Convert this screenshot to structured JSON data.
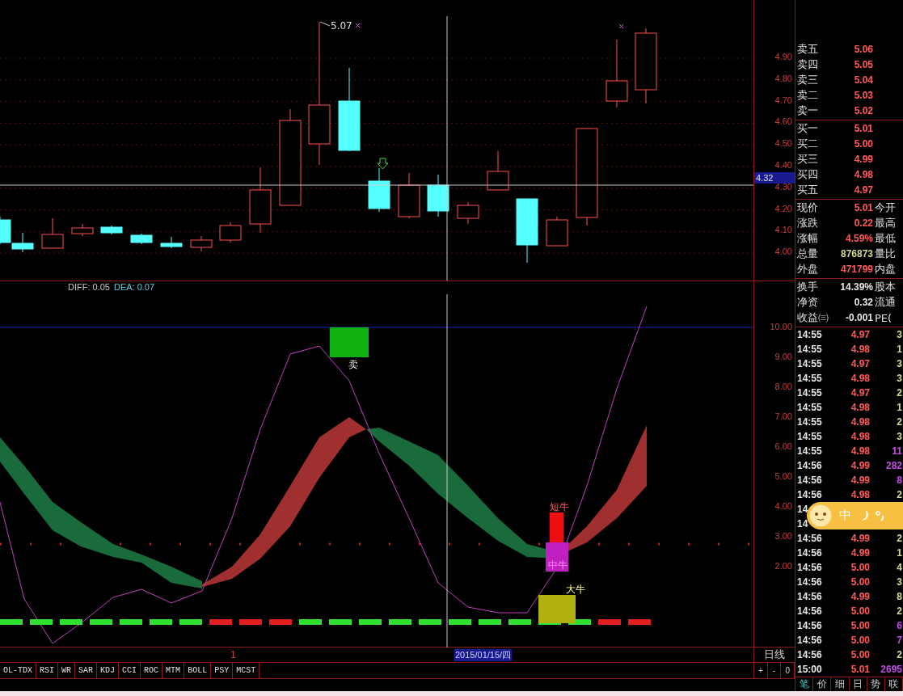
{
  "price_pane": {
    "high_label": "5.07",
    "cursor_price": "4.32",
    "y_ticks": [
      "4.90",
      "4.80",
      "4.70",
      "4.60",
      "4.50",
      "4.40",
      "4.30",
      "4.20",
      "4.10",
      "4.00"
    ]
  },
  "indicator_pane": {
    "legend": [
      {
        "label": "DIFF: 0.05",
        "color": "#c8c8c8"
      },
      {
        "label": "DEA: 0.07",
        "color": "#60c8d8"
      }
    ],
    "y_ticks": [
      "10.00",
      "9.00",
      "8.00",
      "7.00",
      "6.00",
      "5.00",
      "4.00",
      "3.00",
      "2.00"
    ],
    "signals": [
      {
        "label": "卖",
        "kind": "sell"
      },
      {
        "label": "短牛",
        "kind": "short"
      },
      {
        "label": "中牛",
        "kind": "mid"
      },
      {
        "label": "大牛",
        "kind": "long"
      }
    ]
  },
  "date_bar": {
    "marker": "1",
    "cursor_date": "2015/01/15/四"
  },
  "period": "日线",
  "zoom_buttons": [
    "+",
    "-",
    "0"
  ],
  "indicator_tabs": [
    "OL-TDX",
    "RSI",
    "WR",
    "SAR",
    "KDJ",
    "CCI",
    "ROC",
    "MTM",
    "BOLL",
    "PSY",
    "MCST"
  ],
  "quote": {
    "asks": [
      {
        "label": "卖五",
        "price": "5.06"
      },
      {
        "label": "卖四",
        "price": "5.05"
      },
      {
        "label": "卖三",
        "price": "5.04"
      },
      {
        "label": "卖二",
        "price": "5.03"
      },
      {
        "label": "卖一",
        "price": "5.02"
      }
    ],
    "bids": [
      {
        "label": "买一",
        "price": "5.01"
      },
      {
        "label": "买二",
        "price": "5.00"
      },
      {
        "label": "买三",
        "price": "4.99"
      },
      {
        "label": "买四",
        "price": "4.98"
      },
      {
        "label": "买五",
        "price": "4.97"
      }
    ],
    "stats": [
      {
        "label": "现价",
        "value": "5.01",
        "color": "#ff5a5a",
        "label2": "今开"
      },
      {
        "label": "涨跌",
        "value": "0.22",
        "color": "#ff5a5a",
        "label2": "最高"
      },
      {
        "label": "涨幅",
        "value": "4.59%",
        "color": "#ff5a5a",
        "label2": "最低"
      },
      {
        "label": "总量",
        "value": "876873",
        "color": "#d8d890",
        "label2": "量比"
      },
      {
        "label": "外盘",
        "value": "471799",
        "color": "#ff5a5a",
        "label2": "内盘"
      }
    ],
    "fundamentals": [
      {
        "label": "换手",
        "value": "14.39%",
        "label2": "股本"
      },
      {
        "label": "净资",
        "value": "0.32",
        "label2": "流通"
      },
      {
        "label": "收益㈢",
        "value": "-0.001",
        "label2": "PE("
      }
    ]
  },
  "ticks": [
    {
      "time": "14:55",
      "price": "4.97",
      "volume": "3",
      "color": "#d8d890"
    },
    {
      "time": "14:55",
      "price": "4.98",
      "volume": "1",
      "color": "#d8d890"
    },
    {
      "time": "14:55",
      "price": "4.97",
      "volume": "3",
      "color": "#d8d890"
    },
    {
      "time": "14:55",
      "price": "4.98",
      "volume": "3",
      "color": "#d8d890"
    },
    {
      "time": "14:55",
      "price": "4.97",
      "volume": "2",
      "color": "#d8d890"
    },
    {
      "time": "14:55",
      "price": "4.98",
      "volume": "1",
      "color": "#d8d890"
    },
    {
      "time": "14:55",
      "price": "4.98",
      "volume": "2",
      "color": "#d8d890"
    },
    {
      "time": "14:55",
      "price": "4.98",
      "volume": "3",
      "color": "#d8d890"
    },
    {
      "time": "14:55",
      "price": "4.98",
      "volume": "11",
      "color": "#c050e0"
    },
    {
      "time": "14:56",
      "price": "4.99",
      "volume": "282",
      "color": "#c050e0"
    },
    {
      "time": "14:56",
      "price": "4.99",
      "volume": "8",
      "color": "#c050e0"
    },
    {
      "time": "14:56",
      "price": "4.98",
      "volume": "2",
      "color": "#d8d890"
    },
    {
      "time": "14"
    },
    {
      "time": "14"
    },
    {
      "time": "14:56",
      "price": "4.99",
      "volume": "2",
      "color": "#d8d890"
    },
    {
      "time": "14:56",
      "price": "4.99",
      "volume": "1",
      "color": "#d8d890"
    },
    {
      "time": "14:56",
      "price": "5.00",
      "volume": "4",
      "color": "#d8d890"
    },
    {
      "time": "14:56",
      "price": "5.00",
      "volume": "3",
      "color": "#d8d890"
    },
    {
      "time": "14:56",
      "price": "4.99",
      "volume": "8",
      "color": "#d8d890"
    },
    {
      "time": "14:56",
      "price": "5.00",
      "volume": "2",
      "color": "#d8d890"
    },
    {
      "time": "14:56",
      "price": "5.00",
      "volume": "6",
      "color": "#c050e0"
    },
    {
      "time": "14:56",
      "price": "5.00",
      "volume": "7",
      "color": "#c050e0"
    },
    {
      "time": "14:56",
      "price": "5.00",
      "volume": "2",
      "color": "#d8d890"
    },
    {
      "time": "15:00",
      "price": "5.01",
      "volume": "2695",
      "color": "#c050e0"
    }
  ],
  "bottom_tabs": [
    {
      "label": "笔",
      "selected": true
    },
    {
      "label": "价",
      "selected": false
    },
    {
      "label": "细",
      "selected": false
    },
    {
      "label": "日",
      "selected": false
    },
    {
      "label": "势",
      "selected": false
    },
    {
      "label": "联",
      "selected": false
    }
  ],
  "ime_bar": {
    "label": "中"
  }
}
